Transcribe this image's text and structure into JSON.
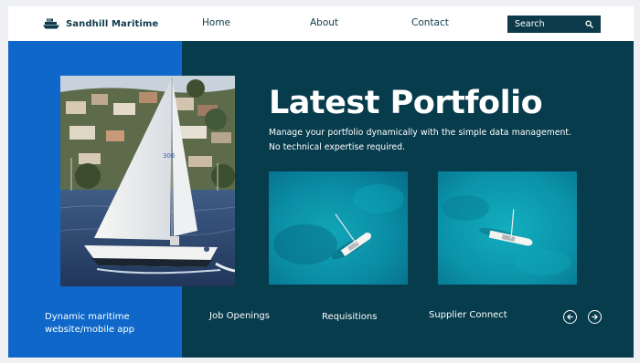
{
  "header": {
    "brand_name": "Sandhill Maritime",
    "brand_icon": "ship-icon",
    "nav": [
      {
        "label": "Home"
      },
      {
        "label": "About"
      },
      {
        "label": "Contact"
      }
    ],
    "search": {
      "placeholder": "Search",
      "icon": "search-icon"
    }
  },
  "hero": {
    "title": "Latest Portfolio",
    "description": "Manage your portfolio dynamically with the simple data management. No technical expertise required.",
    "main_image": "sailboat-photo",
    "thumbnails": [
      "aerial-boat-photo-1",
      "aerial-boat-photo-2"
    ]
  },
  "footer": {
    "caption": "Dynamic maritime website/mobile app",
    "links": [
      {
        "label": "Job Openings"
      },
      {
        "label": "Requisitions"
      },
      {
        "label": "Supplier Connect"
      }
    ],
    "prev_icon": "arrow-left-icon",
    "next_icon": "arrow-right-icon"
  },
  "colors": {
    "brand_navy": "#0e3a4c",
    "hero_blue": "#0f68c9",
    "hero_teal": "#073c4d",
    "text_white": "#ffffff"
  }
}
